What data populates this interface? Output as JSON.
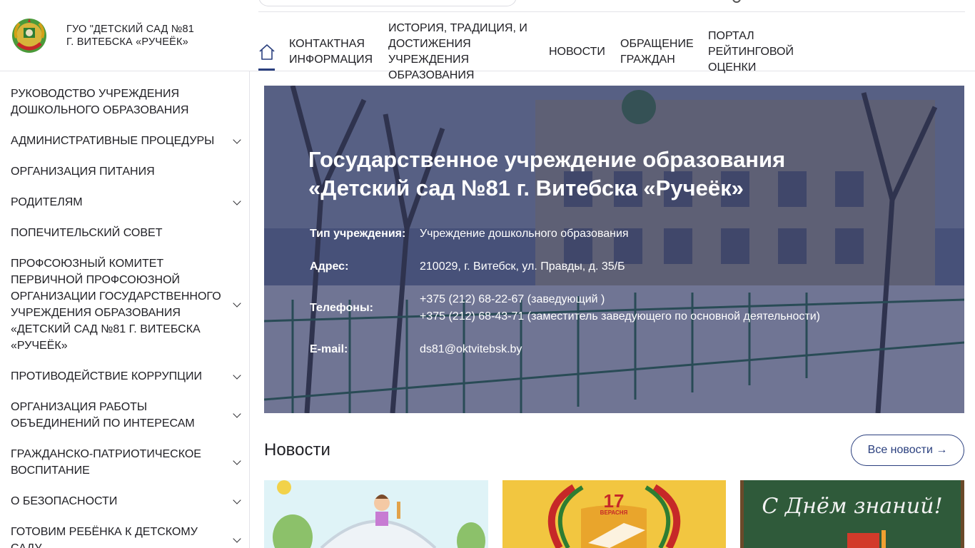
{
  "header": {
    "title_line1": "ГУО \"ДЕТСКИЙ САД №81",
    "title_line2": "Г. ВИТЕБСКА «РУЧЕЁК»",
    "home_icon": "home-icon",
    "nav": [
      {
        "l1": "КОНТАКТНАЯ",
        "l2": "ИНФОРМАЦИЯ",
        "l3": "",
        "l4": ""
      },
      {
        "l1": "ИСТОРИЯ, ТРАДИЦИЯ, И",
        "l2": "ДОСТИЖЕНИЯ",
        "l3": "УЧРЕЖДЕНИЯ",
        "l4": "ОБРАЗОВАНИЯ"
      },
      {
        "l1": "НОВОСТИ",
        "l2": "",
        "l3": "",
        "l4": ""
      },
      {
        "l1": "ОБРАЩЕНИЕ",
        "l2": "ГРАЖДАН",
        "l3": "",
        "l4": ""
      },
      {
        "l1": "ПОРТАЛ",
        "l2": "РЕЙТИНГОВОЙ",
        "l3": "ОЦЕНКИ",
        "l4": ""
      }
    ]
  },
  "sidebar": {
    "items": [
      {
        "label": "РУКОВОДСТВО УЧРЕЖДЕНИЯ ДОШКОЛЬНОГО ОБРАЗОВАНИЯ",
        "expandable": false
      },
      {
        "label": "АДМИНИСТРАТИВНЫЕ ПРОЦЕДУРЫ",
        "expandable": true
      },
      {
        "label": "ОРГАНИЗАЦИЯ ПИТАНИЯ",
        "expandable": false
      },
      {
        "label": "РОДИТЕЛЯМ",
        "expandable": true
      },
      {
        "label": "ПОПЕЧИТЕЛЬСКИЙ СОВЕТ",
        "expandable": false
      },
      {
        "label": "ПРОФСОЮЗНЫЙ КОМИТЕТ ПЕРВИЧНОЙ ПРОФСОЮЗНОЙ ОРГАНИЗАЦИИ ГОСУДАРСТВЕННОГО УЧРЕЖДЕНИЯ ОБРАЗОВАНИЯ «ДЕТСКИЙ САД №81 Г. ВИТЕБСКА «РУЧЕЁК»",
        "expandable": true
      },
      {
        "label": "ПРОТИВОДЕЙСТВИЕ КОРРУПЦИИ",
        "expandable": true
      },
      {
        "label": "ОРГАНИЗАЦИЯ РАБОТЫ ОБЪЕДИНЕНИЙ ПО ИНТЕРЕСАМ",
        "expandable": true
      },
      {
        "label": "ГРАЖДАНСКО-ПАТРИОТИЧЕСКОЕ ВОСПИТАНИЕ",
        "expandable": true
      },
      {
        "label": "О БЕЗОПАСНОСТИ",
        "expandable": true
      },
      {
        "label": "ГОТОВИМ РЕБЁНКА К ДЕТСКОМУ САДУ",
        "expandable": true
      }
    ]
  },
  "hero": {
    "title_line1": "Государственное учреждение образования",
    "title_line2": "«Детский сад №81 г. Витебска «Ручеёк»",
    "type_label": "Тип учреждения:",
    "type_value": "Учреждение дошкольного образования",
    "address_label": "Адрес:",
    "address_value": "210029, г. Витебск, ул. Правды, д. 35/Б",
    "phones_label": "Телефоны:",
    "phone1": "+375 (212) 68-22-67 (заведующий )",
    "phone2": "+375 (212) 68-43-71 (заместитель заведующего по основной деятельности)",
    "email_label": "E-mail:",
    "email_value": "ds81@oktvitebsk.by"
  },
  "news": {
    "title": "Новости",
    "all_button": "Все новости →",
    "cards": [
      {
        "image": "children-illustration"
      },
      {
        "image": "holiday-17-september",
        "date_num": "17",
        "date_word": "ВЕРАСНЯ"
      },
      {
        "image": "chalkboard-knowledge-day",
        "board_text": "С Днём знаний!"
      }
    ]
  },
  "colors": {
    "accent": "#2a3f7e",
    "overlay": "#262e5c",
    "text": "#1f1f24"
  }
}
